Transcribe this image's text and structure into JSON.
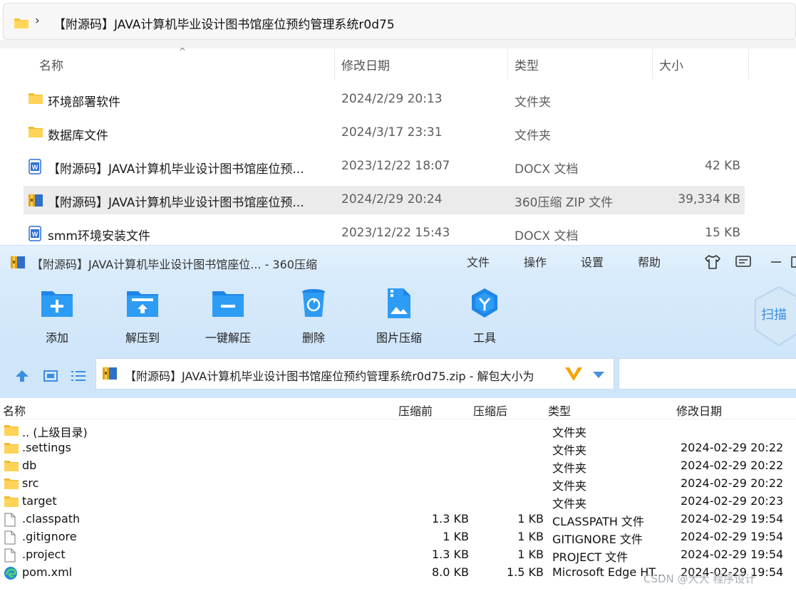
{
  "explorer": {
    "path": "【附源码】JAVA计算机毕业设计图书馆座位预约管理系统r0d75",
    "columns": {
      "name": "名称",
      "date": "修改日期",
      "type": "类型",
      "size": "大小"
    },
    "rows": [
      {
        "name": "环境部署软件",
        "date": "2024/2/29 20:13",
        "type": "文件夹",
        "size": "",
        "icon": "folder-icon"
      },
      {
        "name": "数据库文件",
        "date": "2024/3/17 23:31",
        "type": "文件夹",
        "size": "",
        "icon": "folder-icon"
      },
      {
        "name": "【附源码】JAVA计算机毕业设计图书馆座位预...",
        "date": "2023/12/22 18:07",
        "type": "DOCX 文档",
        "size": "42 KB",
        "icon": "word-doc-icon"
      },
      {
        "name": "【附源码】JAVA计算机毕业设计图书馆座位预...",
        "date": "2024/2/29 20:24",
        "type": "360压缩 ZIP 文件",
        "size": "39,334 KB",
        "icon": "zip-archive-icon"
      },
      {
        "name": "smm环境安装文件",
        "date": "2023/12/22 15:43",
        "type": "DOCX 文档",
        "size": "15 KB",
        "icon": "word-doc-icon"
      }
    ]
  },
  "zip": {
    "title": "【附源码】JAVA计算机毕业设计图书馆座位... - 360压缩",
    "menu": [
      "文件",
      "操作",
      "设置",
      "帮助"
    ],
    "tools": [
      {
        "label": "添加",
        "icon": "add-icon"
      },
      {
        "label": "解压到",
        "icon": "extract-to-icon"
      },
      {
        "label": "一键解压",
        "icon": "one-click-extract-icon"
      },
      {
        "label": "删除",
        "icon": "delete-icon"
      },
      {
        "label": "图片压缩",
        "icon": "image-compress-icon"
      },
      {
        "label": "工具",
        "icon": "tools-icon"
      }
    ],
    "scan_label": "扫描",
    "path": "【附源码】JAVA计算机毕业设计图书馆座位预约管理系统r0d75.zip - 解包大小为",
    "headers": {
      "name": "名称",
      "before": "压缩前",
      "after": "压缩后",
      "type": "类型",
      "date": "修改日期"
    },
    "rows": [
      {
        "name": ".. (上级目录)",
        "before": "",
        "after": "",
        "type": "文件夹",
        "date": "",
        "icon": "folder-icon"
      },
      {
        "name": ".settings",
        "before": "",
        "after": "",
        "type": "文件夹",
        "date": "2024-02-29 20:22",
        "icon": "folder-icon"
      },
      {
        "name": "db",
        "before": "",
        "after": "",
        "type": "文件夹",
        "date": "2024-02-29 20:22",
        "icon": "folder-icon"
      },
      {
        "name": "src",
        "before": "",
        "after": "",
        "type": "文件夹",
        "date": "2024-02-29 20:22",
        "icon": "folder-icon"
      },
      {
        "name": "target",
        "before": "",
        "after": "",
        "type": "文件夹",
        "date": "2024-02-29 20:23",
        "icon": "folder-icon"
      },
      {
        "name": ".classpath",
        "before": "1.3 KB",
        "after": "1 KB",
        "type": "CLASSPATH 文件",
        "date": "2024-02-29 19:54",
        "icon": "file-icon"
      },
      {
        "name": ".gitignore",
        "before": "1 KB",
        "after": "1 KB",
        "type": "GITIGNORE 文件",
        "date": "2024-02-29 19:54",
        "icon": "file-icon"
      },
      {
        "name": ".project",
        "before": "1.3 KB",
        "after": "1 KB",
        "type": "PROJECT 文件",
        "date": "2024-02-29 19:54",
        "icon": "file-icon"
      },
      {
        "name": "pom.xml",
        "before": "8.0 KB",
        "after": "1.5 KB",
        "type": "Microsoft Edge HT...",
        "date": "2024-02-29 19:54",
        "icon": "edge-icon"
      }
    ]
  },
  "watermark": "CSDN @大大 程序设计"
}
